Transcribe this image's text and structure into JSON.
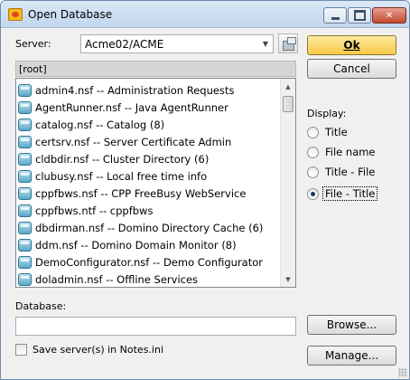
{
  "window": {
    "title": "Open Database"
  },
  "server": {
    "label": "Server:",
    "value": "Acme02/ACME",
    "dropdown_icon": "chevron-down-icon",
    "browse_icon": "server-icon"
  },
  "path": "[root]",
  "databases": [
    "admin4.nsf -- Administration Requests",
    "AgentRunner.nsf -- Java AgentRunner",
    "catalog.nsf -- Catalog (8)",
    "certsrv.nsf -- Server Certificate Admin",
    "cldbdir.nsf -- Cluster Directory (6)",
    "clubusy.nsf -- Local free time info",
    "cppfbws.nsf -- CPP FreeBusy WebService",
    "cppfbws.ntf -- cppfbws",
    "dbdirman.nsf -- Domino Directory Cache (6)",
    "ddm.nsf -- Domino Domain Monitor (8)",
    "DemoConfigurator.nsf -- Demo Configurator",
    "doladmin.nsf -- Offline Services"
  ],
  "buttons": {
    "ok": "Ok",
    "cancel": "Cancel",
    "browse": "Browse...",
    "manage": "Manage..."
  },
  "display": {
    "label": "Display:",
    "options": [
      {
        "label": "Title",
        "checked": false
      },
      {
        "label": "File name",
        "checked": false
      },
      {
        "label": "Title - File",
        "checked": false
      },
      {
        "label": "File - Title",
        "checked": true
      }
    ]
  },
  "database": {
    "label": "Database:",
    "value": ""
  },
  "save_servers": {
    "label": "Save server(s) in Notes.ini",
    "checked": false
  },
  "colors": {
    "ok_button": "#f7c948",
    "selection_dot": "#20375a",
    "db_icon": "#59a8c7"
  }
}
